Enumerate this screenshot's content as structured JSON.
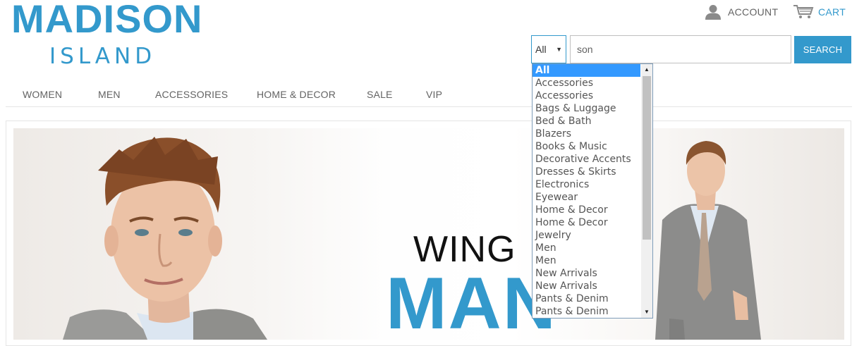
{
  "logo": {
    "top": "MADISON",
    "bottom": "ISLAND"
  },
  "header": {
    "account_label": "ACCOUNT",
    "cart_label": "CART"
  },
  "search": {
    "category_value": "All",
    "query": "son",
    "button_label": "SEARCH"
  },
  "nav": {
    "items": [
      "WOMEN",
      "MEN",
      "ACCESSORIES",
      "HOME & DECOR",
      "SALE",
      "VIP"
    ]
  },
  "hero": {
    "line1": "WING",
    "line2": "MAN"
  },
  "dropdown": {
    "options": [
      "All",
      "Accessories",
      "Accessories",
      "Bags & Luggage",
      "Bed & Bath",
      "Blazers",
      "Books & Music",
      "Decorative Accents",
      "Dresses & Skirts",
      "Electronics",
      "Eyewear",
      "Home & Decor",
      "Home & Decor",
      "Jewelry",
      "Men",
      "Men",
      "New Arrivals",
      "New Arrivals",
      "Pants & Denim",
      "Pants & Denim"
    ],
    "selected_index": 0
  },
  "colors": {
    "accent": "#3399cc",
    "text": "#636363",
    "selection": "#3399ff"
  },
  "icons": [
    "user-icon",
    "cart-icon",
    "select-arrow-icon",
    "scroll-up-icon",
    "scroll-down-icon"
  ]
}
